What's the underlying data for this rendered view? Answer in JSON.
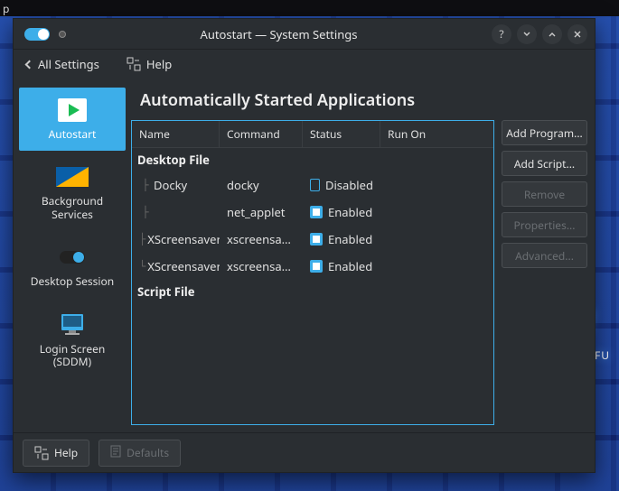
{
  "window": {
    "title": "Autostart — System Settings"
  },
  "subheader": {
    "all_settings": "All Settings",
    "help": "Help"
  },
  "sidebar": {
    "items": [
      {
        "label": "Autostart"
      },
      {
        "label": "Background Services"
      },
      {
        "label": "Desktop Session"
      },
      {
        "label": "Login Screen (SDDM)"
      }
    ]
  },
  "page": {
    "heading": "Automatically Started Applications",
    "columns": {
      "name": "Name",
      "command": "Command",
      "status": "Status",
      "runon": "Run On"
    },
    "groups": {
      "desktop_file": "Desktop File",
      "script_file": "Script File"
    },
    "rows": [
      {
        "name": "Docky",
        "command": "docky",
        "enabled": false,
        "status_label": "Disabled"
      },
      {
        "name": "",
        "command": "net_applet",
        "enabled": true,
        "status_label": "Enabled"
      },
      {
        "name": "XScreensaver",
        "command": "xscreensaver ...",
        "enabled": true,
        "status_label": "Enabled"
      },
      {
        "name": "XScreensaver",
        "command": "xscreensaver",
        "enabled": true,
        "status_label": "Enabled"
      }
    ],
    "status_labels": {
      "enabled": "Enabled",
      "disabled": "Disabled"
    },
    "buttons": {
      "add_program": "Add Program...",
      "add_script": "Add Script...",
      "remove": "Remove",
      "properties": "Properties...",
      "advanced": "Advanced..."
    }
  },
  "footer": {
    "help": "Help",
    "defaults": "Defaults"
  },
  "colors": {
    "accent": "#3daee9"
  }
}
